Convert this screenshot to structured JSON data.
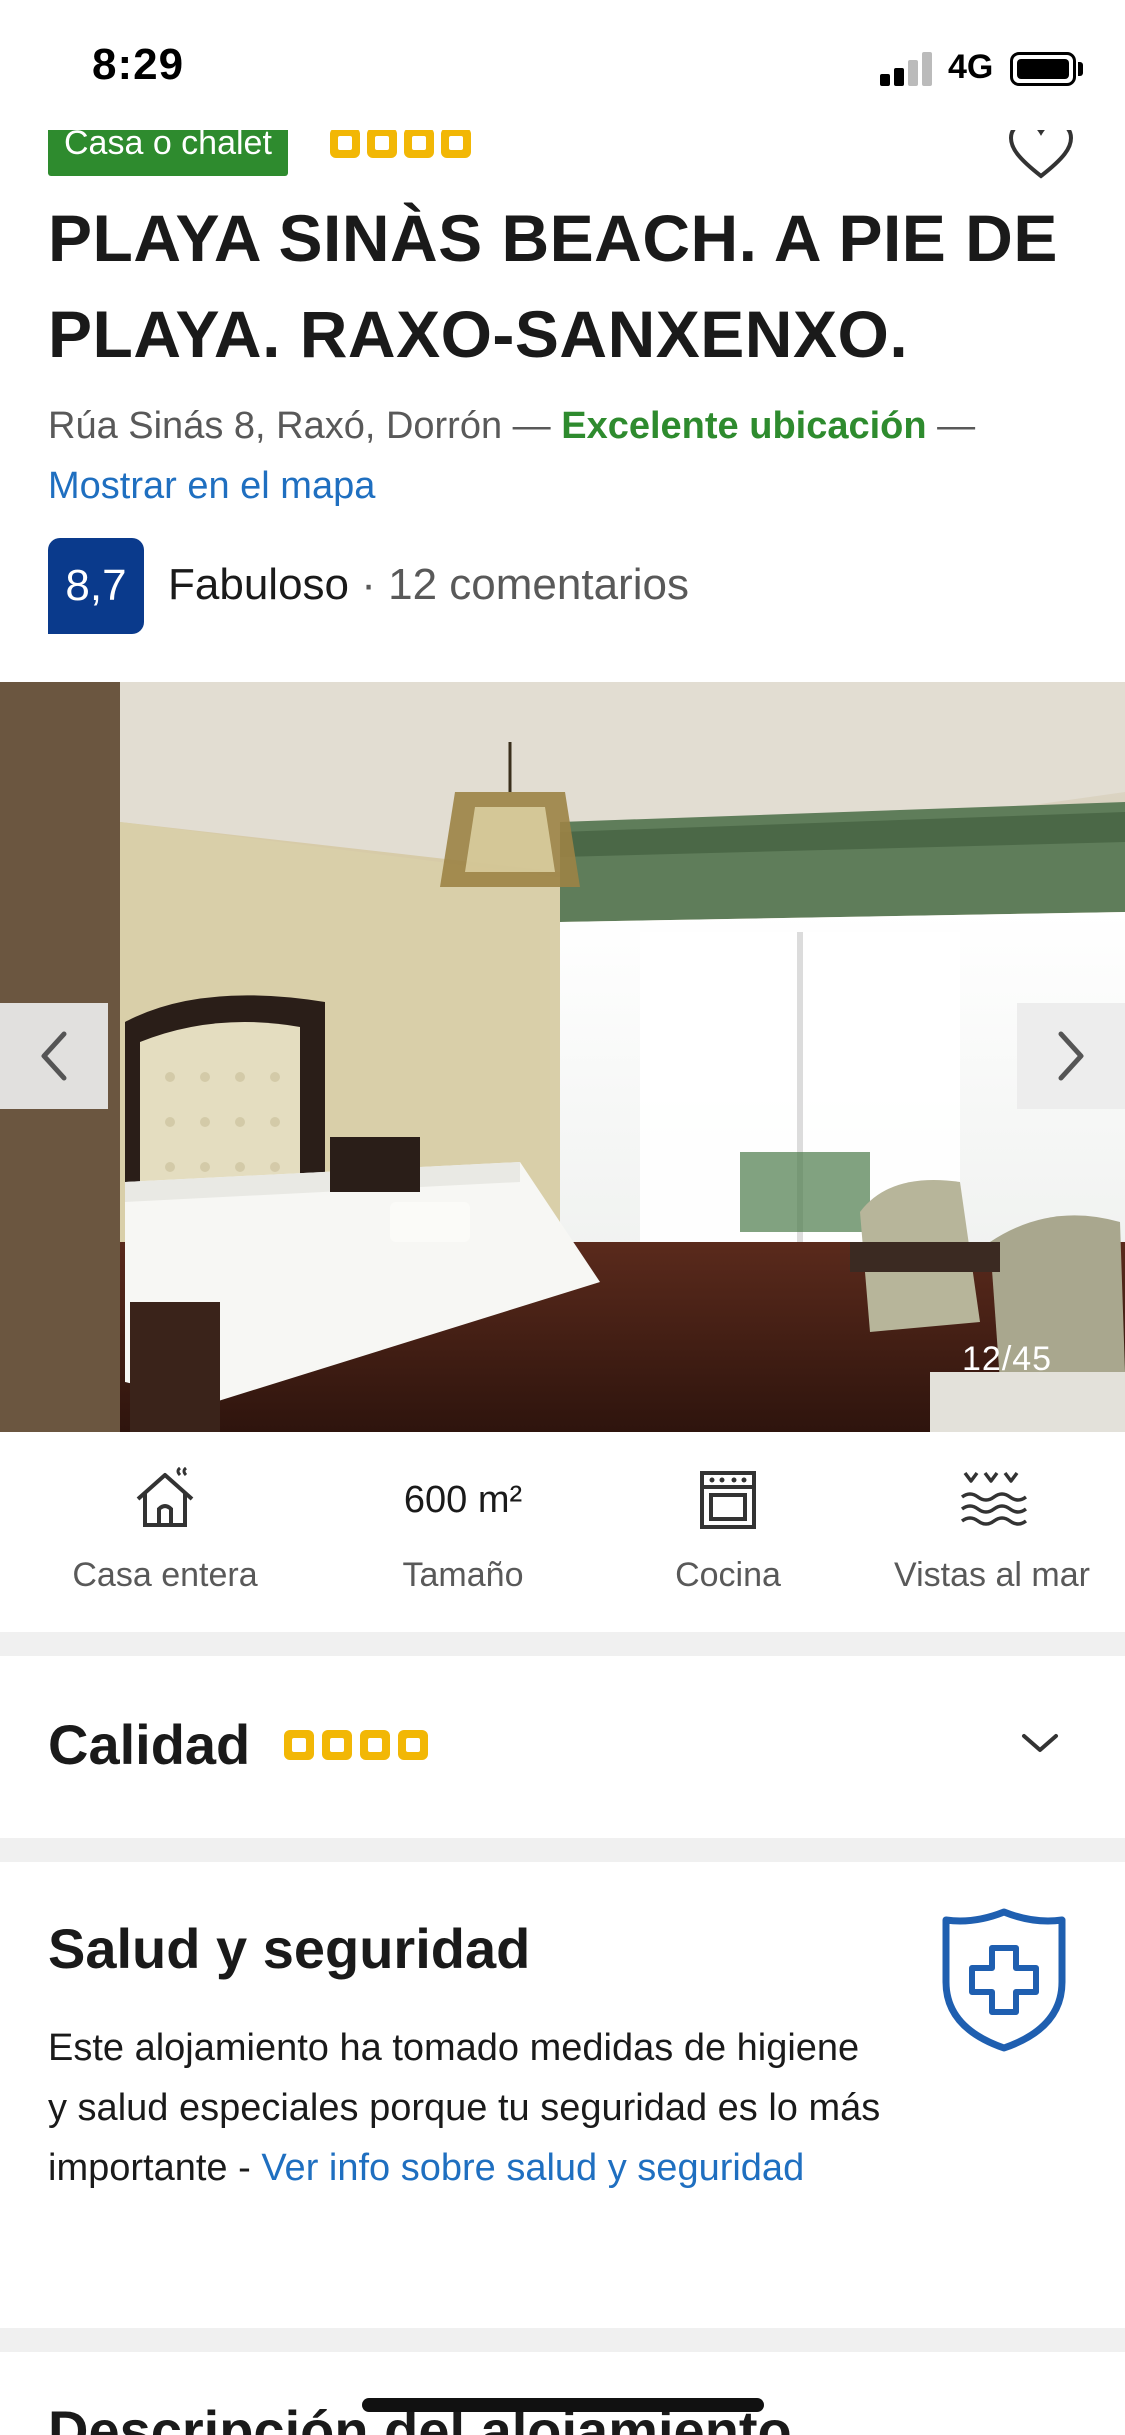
{
  "status_bar": {
    "time": "8:29",
    "network": "4G"
  },
  "property": {
    "type_badge": "Casa o chalet",
    "star_rating": 4,
    "title": "PLAYA SINÀS BEACH. A PIE DE PLAYA. RAXO-SANXENXO.",
    "address": "Rúa Sinás 8, Raxó, Dorrón",
    "separator": "—",
    "location_highlight": "Excelente ubicación",
    "map_link": "Mostrar en el mapa",
    "score": "8,7",
    "score_label": "Fabuloso",
    "reviews": "· 12 comentarios"
  },
  "gallery": {
    "counter": "12/45"
  },
  "features": [
    {
      "icon": "house-icon",
      "value": "",
      "label": "Casa entera"
    },
    {
      "icon": "",
      "value": "600 m²",
      "label": "Tamaño"
    },
    {
      "icon": "oven-icon",
      "value": "",
      "label": "Cocina"
    },
    {
      "icon": "sea-view-icon",
      "value": "",
      "label": "Vistas al mar"
    }
  ],
  "quality": {
    "title": "Calidad",
    "stars": 4
  },
  "health": {
    "title": "Salud y seguridad",
    "text": "Este alojamiento ha tomado medidas de higiene y salud especiales porque tu seguridad es lo más importante -",
    "link": "Ver info sobre salud y seguridad"
  },
  "next_section": {
    "title": "Descripción del alojamiento"
  },
  "colors": {
    "accent_green": "#2e8b2e",
    "link_blue": "#1f6fc0",
    "score_navy": "#0a3a8c",
    "star_yellow": "#f2b705"
  }
}
